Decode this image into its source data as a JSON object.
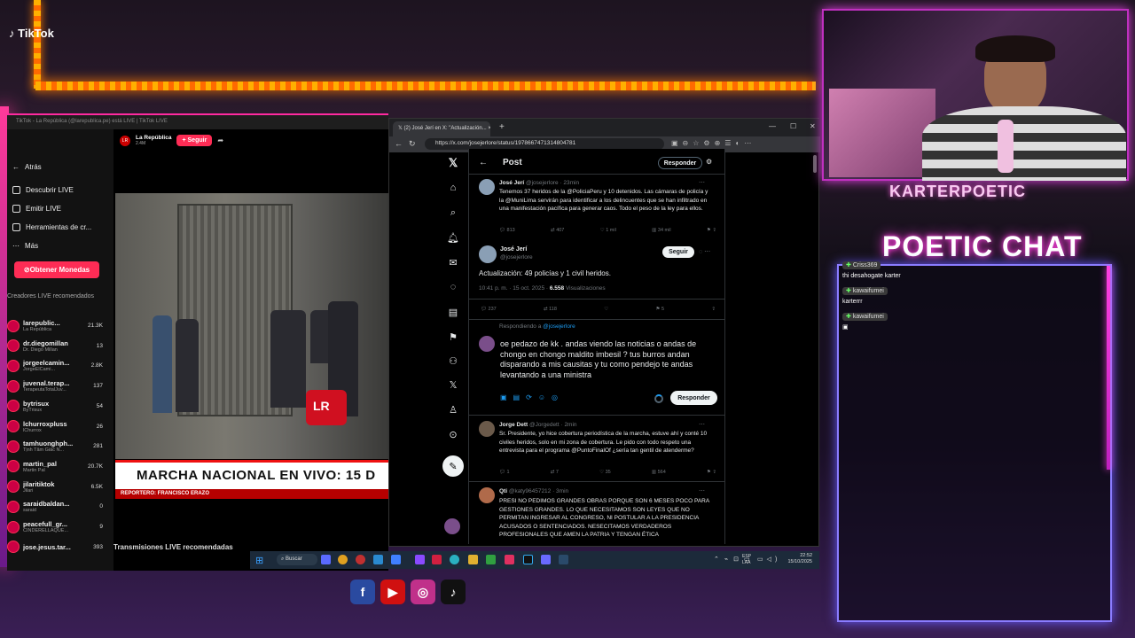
{
  "tiktok": {
    "tab_title": "TikTok - La República (@larepublica.pe) está LIVE | TikTok LIVE",
    "logo": "TikTok",
    "nav": [
      {
        "label": "Atrás",
        "icon": "arrow-left-icon"
      },
      {
        "label": "Descubrir LIVE",
        "icon": "compass-icon"
      },
      {
        "label": "Emitir LIVE",
        "icon": "broadcast-icon"
      },
      {
        "label": "Herramientas de cr...",
        "icon": "tools-icon"
      },
      {
        "label": "Más",
        "icon": "more-icon"
      }
    ],
    "coins_button": "Obtener Monedas",
    "section_title": "Creadores LIVE recomendados",
    "creators": [
      {
        "name": "larepublic...",
        "sub": "La República",
        "count": "21.3K"
      },
      {
        "name": "dr.diegomillan",
        "sub": "Dr. Diego Millan",
        "count": "13"
      },
      {
        "name": "jorgeelcamin...",
        "sub": "JorgeElCami...",
        "count": "2.8K"
      },
      {
        "name": "juvenal.terap...",
        "sub": "TerapeutaTotalJuv...",
        "count": "137"
      },
      {
        "name": "bytrisux",
        "sub": "ByTrisux",
        "count": "54"
      },
      {
        "name": "lchurroxpluss",
        "sub": "lChurrox",
        "count": "26"
      },
      {
        "name": "tamhuonghph...",
        "sub": "Tịnh Tâm Giác N...",
        "count": "281"
      },
      {
        "name": "martin_pal",
        "sub": "Martin Pal",
        "count": "20.7K"
      },
      {
        "name": "jilaritiktok",
        "sub": "Jilari",
        "count": "6.5K"
      },
      {
        "name": "saraidbaldan...",
        "sub": "saraid",
        "count": "0"
      },
      {
        "name": "peacefull_gr...",
        "sub": "CINDERELLAQUE...",
        "count": "9"
      },
      {
        "name": "jose.jesus.tar...",
        "sub": "",
        "count": "393"
      }
    ],
    "channel": "La República",
    "channel_viewers": "2.4M",
    "follow": "Seguir",
    "banner": "MARCHA NACIONAL EN VIVO: 15 D",
    "reporter": "REPORTERO: FRANCISCO ERAZO",
    "recommended": "Transmisiones LIVE recomendadas"
  },
  "browser": {
    "tab_title": "(2) José Jerí en X: \"Actualización...",
    "url": "https://x.com/josejerlore/status/1978667471314804781"
  },
  "x": {
    "header": "Post",
    "reply_header_button": "Responder",
    "tweets": [
      {
        "name": "José Jerí",
        "handle": "@josejerlore · 23min",
        "text": "Tenemos 37 heridos de la @PoliciaPeru y 10 detenidos. Las cámaras de policía y la @MuniLima servirán para identificar a los delincuentes que se han infiltrado en una manifestación pacífica para generar caos. Todo el peso de la ley para ellos.",
        "replies": "813",
        "reposts": "407",
        "likes": "1 mil",
        "views": "34 mil"
      }
    ],
    "main": {
      "name": "José Jerí",
      "handle": "@josejerlore",
      "follow": "Seguir",
      "text": "Actualización: 49 policías y 1 civil heridos.",
      "time": "10:41 p. m. · 15 oct. 2025 ·",
      "views_num": "6.558",
      "views_label": "Visualizaciones",
      "replies": "237",
      "reposts": "118",
      "likes": "",
      "bookmarks": "5"
    },
    "composer": {
      "replying_prefix": "Respondiendo a",
      "replying_to": "@josejerlore",
      "text": "oe pedazo de kk . andas viendo las noticias o andas de chongo en chongo maldito imbesil ? tus burros andan disparando a mis causitas y tu como pendejo te andas levantando a una ministra",
      "button": "Responder"
    },
    "replies": [
      {
        "name": "Jorge Dett",
        "handle": "@Jorgedett · 2min",
        "text": "Sr. Presidente, yo hice cobertura periodística de la marcha, estuve ahí y conté 10 civiles heridos, solo en mi zona de cobertura. Le pido con todo respeto una entrevista para el programa @PuntoFinalOf ¿sería tan gentil de atenderme?",
        "replies": "1",
        "reposts": "7",
        "likes": "35",
        "views": "564"
      },
      {
        "name": "Qti",
        "handle": "@katy96457212 · 3min",
        "text": "PRESI NO PEDIMOS GRANDES OBRAS PORQUE SON 6 MESES POCO PARA GESTIONES GRANDES. LO QUE NECESITAMOS SON LEYES QUE NO PERMITAN INGRESAR AL CONGRESO, NI POSTULAR A LA PRESIDENCIA ACUSADOS O SENTENCIADOS. NESECITAMOS VERDADEROS PROFESIONALES QUE AMEN LA PATRIA Y TENGAN ÉTICA"
      }
    ]
  },
  "taskbar": {
    "search": "Buscar",
    "lang": "ESP",
    "lang2": "LAA",
    "time": "22:52",
    "date": "15/10/2025"
  },
  "stream": {
    "streamer": "KARTERPOETIC",
    "chat_title": "POETIC CHAT",
    "chat": [
      {
        "user": "Criss369",
        "msg": "thi desahogate karter"
      },
      {
        "user": "kawaifumei",
        "msg": "karterrr"
      },
      {
        "user": "kawaifumei",
        "msg": ""
      }
    ]
  }
}
